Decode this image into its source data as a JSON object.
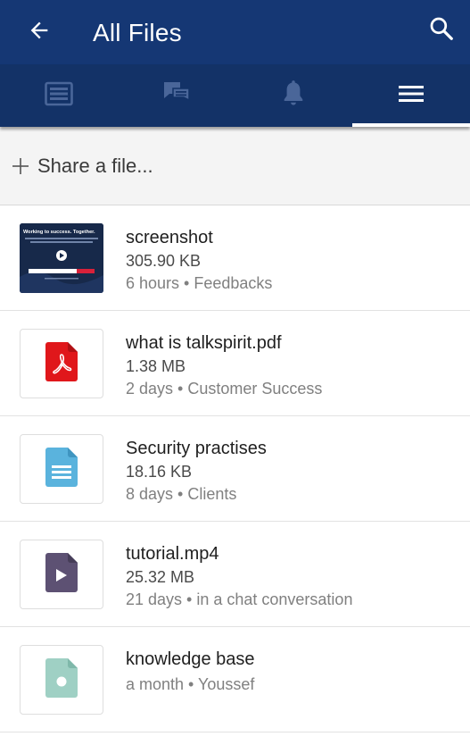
{
  "header": {
    "title": "All Files",
    "back_icon": "arrow-left-icon",
    "search_icon": "search-icon"
  },
  "tabs": [
    {
      "icon": "news-feed-icon",
      "active": false
    },
    {
      "icon": "chat-bubbles-icon",
      "active": false
    },
    {
      "icon": "bell-icon",
      "active": false
    },
    {
      "icon": "menu-icon",
      "active": true
    }
  ],
  "share": {
    "label": "Share a file..."
  },
  "files": [
    {
      "name": "screenshot",
      "size": "305.90 KB",
      "meta": "6 hours • Feedbacks",
      "icon": "image-thumbnail",
      "thumb_text": "Working to success. Together."
    },
    {
      "name": "what is talkspirit.pdf",
      "size": "1.38 MB",
      "meta": "2 days • Customer Success",
      "icon": "pdf-file-icon"
    },
    {
      "name": "Security practises",
      "size": "18.16 KB",
      "meta": "8 days • Clients",
      "icon": "document-file-icon"
    },
    {
      "name": "tutorial.mp4",
      "size": "25.32 MB",
      "meta": "21 days • in a chat conversation",
      "icon": "video-file-icon"
    },
    {
      "name": "knowledge base",
      "size": "",
      "meta": "a month • Youssef",
      "icon": "generic-file-icon"
    }
  ],
  "colors": {
    "header": "#153774",
    "tabbar": "#133267",
    "pdf": "#e0171b",
    "doc": "#5ab3dd",
    "video": "#5d5173",
    "generic": "#9fd0c4"
  }
}
